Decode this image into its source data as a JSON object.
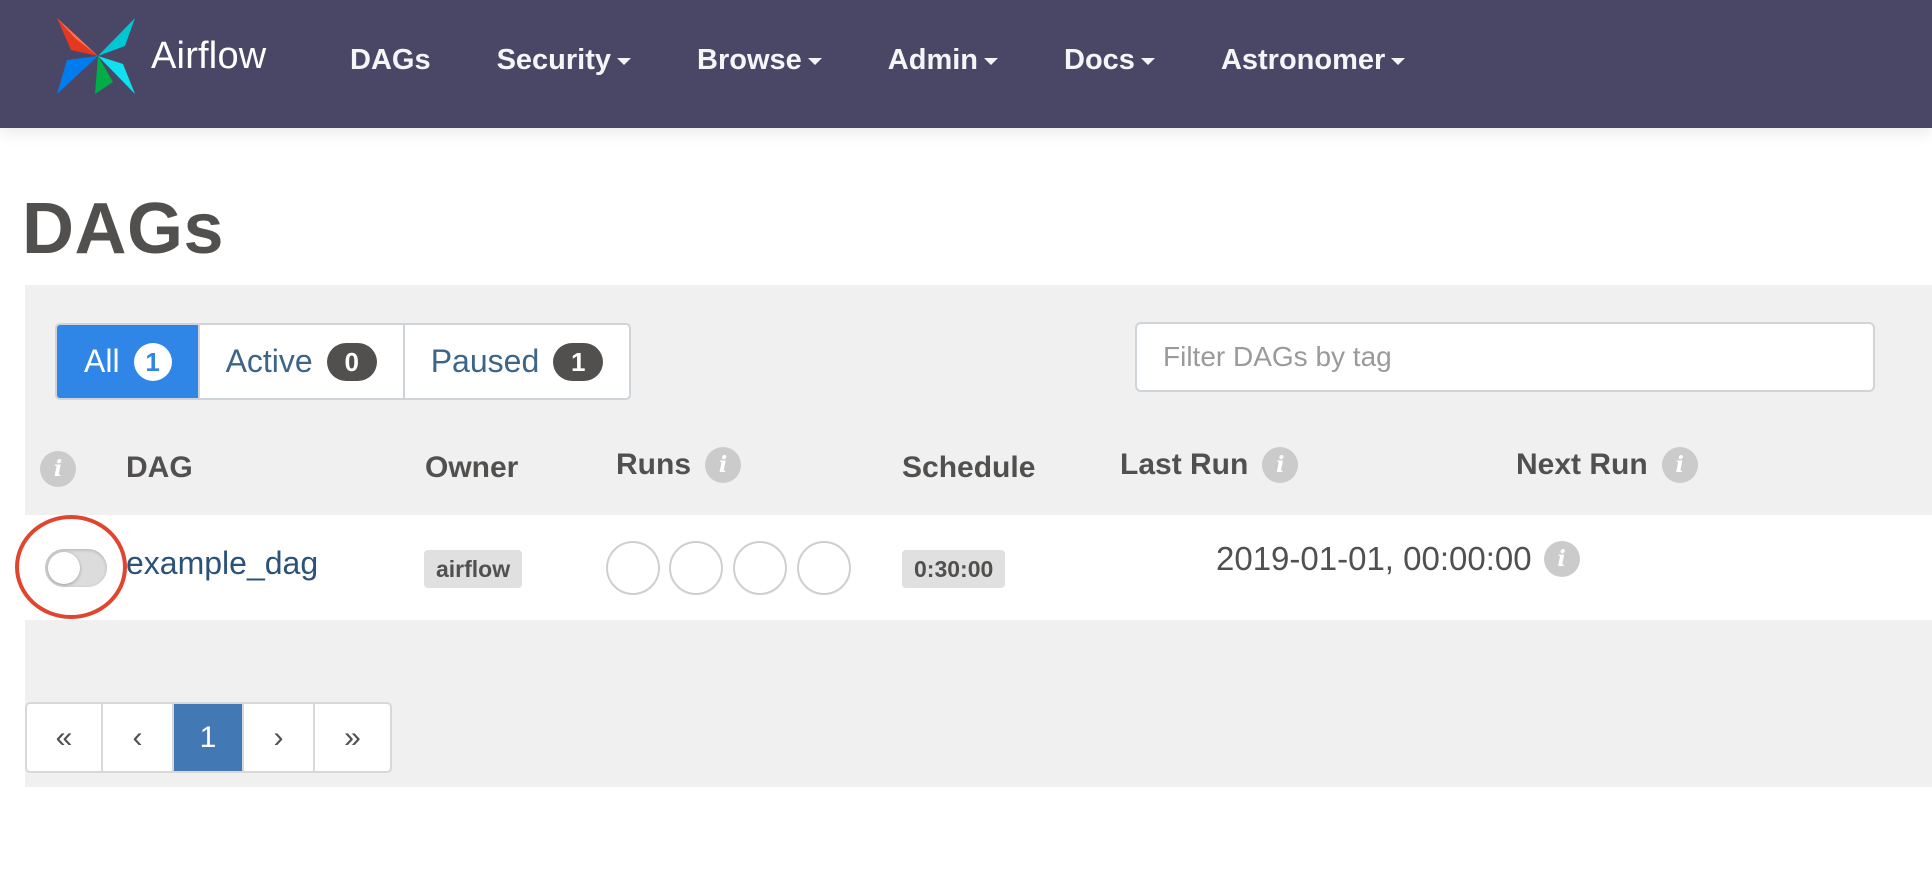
{
  "navbar": {
    "brand": "Airflow",
    "items": [
      {
        "label": "DAGs",
        "dropdown": false
      },
      {
        "label": "Security",
        "dropdown": true
      },
      {
        "label": "Browse",
        "dropdown": true
      },
      {
        "label": "Admin",
        "dropdown": true
      },
      {
        "label": "Docs",
        "dropdown": true
      },
      {
        "label": "Astronomer",
        "dropdown": true
      }
    ]
  },
  "page": {
    "title": "DAGs"
  },
  "filters": {
    "tabs": [
      {
        "label": "All",
        "count": "1",
        "active": true
      },
      {
        "label": "Active",
        "count": "0",
        "active": false
      },
      {
        "label": "Paused",
        "count": "1",
        "active": false
      }
    ],
    "tag_placeholder": "Filter DAGs by tag"
  },
  "table": {
    "columns": [
      "DAG",
      "Owner",
      "Runs",
      "Schedule",
      "Last Run",
      "Next Run"
    ],
    "rows": [
      {
        "dag": "example_dag",
        "owner": "airflow",
        "schedule": "0:30:00",
        "last_run": "",
        "next_run": "2019-01-01, 00:00:00",
        "paused": true
      }
    ]
  },
  "pagination": {
    "first": "«",
    "prev": "‹",
    "current": "1",
    "next": "›",
    "last": "»"
  },
  "colors": {
    "navbar": "#4a4766",
    "active_tab": "#2f86e6",
    "current_page": "#4278b3",
    "highlight": "#e0462f"
  }
}
